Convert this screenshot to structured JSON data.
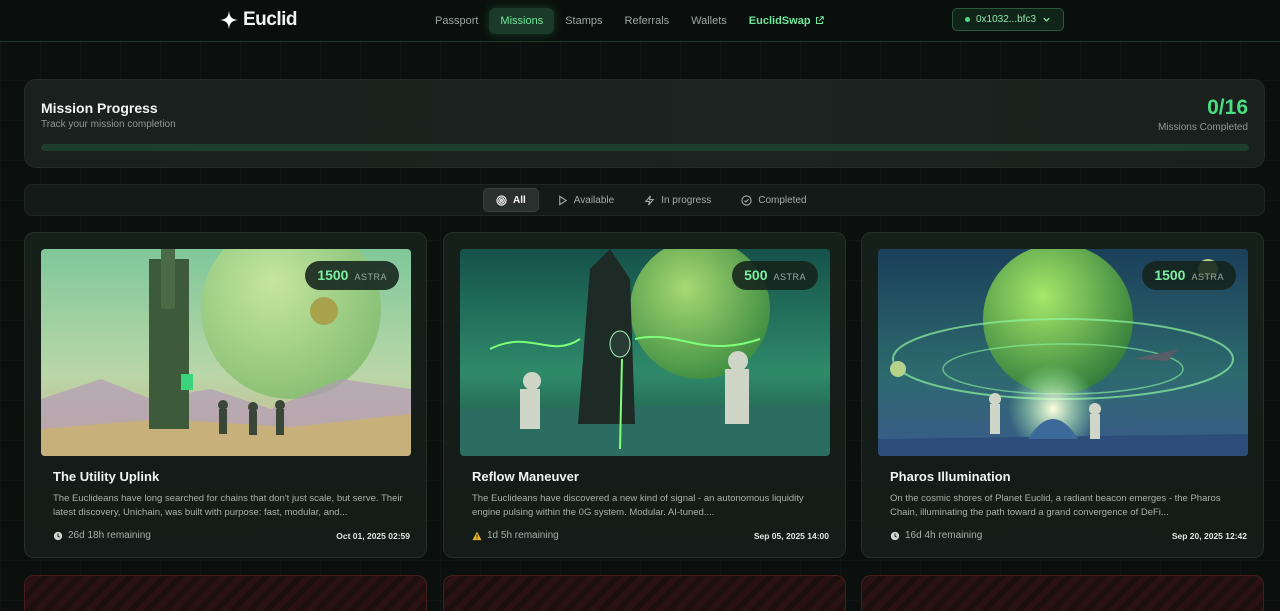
{
  "nav": {
    "logo": "Euclid",
    "items": [
      {
        "label": "Passport",
        "active": false
      },
      {
        "label": "Missions",
        "active": true
      },
      {
        "label": "Stamps",
        "active": false
      },
      {
        "label": "Referrals",
        "active": false
      },
      {
        "label": "Wallets",
        "active": false
      }
    ],
    "external": "EuclidSwap",
    "wallet": "0x1032...bfc3"
  },
  "progress": {
    "title": "Mission Progress",
    "subtitle": "Track your mission completion",
    "count": "0/16",
    "count_label": "Missions Completed",
    "fraction": 0
  },
  "filters": [
    {
      "label": "All",
      "icon": "target-icon",
      "active": true
    },
    {
      "label": "Available",
      "icon": "play-icon",
      "active": false
    },
    {
      "label": "In progress",
      "icon": "bolt-icon",
      "active": false
    },
    {
      "label": "Completed",
      "icon": "check-circle-icon",
      "active": false
    }
  ],
  "missions": [
    {
      "title": "The Utility Uplink",
      "description": "The Euclideans have long searched for chains that don't just scale, but serve. Their latest discovery, Unichain, was built with purpose: fast, modular, and...",
      "reward": "1500",
      "reward_unit": "ASTRA",
      "remaining": "26d 18h remaining",
      "remaining_icon": "clock-icon",
      "date": "Oct 01, 2025 02:59"
    },
    {
      "title": "Reflow Maneuver",
      "description": "The Euclideans have discovered a new kind of signal - an autonomous liquidity engine pulsing within the 0G system. Modular. AI-tuned....",
      "reward": "500",
      "reward_unit": "ASTRA",
      "remaining": "1d 5h remaining",
      "remaining_icon": "warning-icon",
      "date": "Sep 05, 2025 14:00"
    },
    {
      "title": "Pharos Illumination",
      "description": "On the cosmic shores of Planet Euclid, a radiant beacon emerges - the Pharos Chain, illuminating the path toward a grand convergence of DeFi...",
      "reward": "1500",
      "reward_unit": "ASTRA",
      "remaining": "16d 4h remaining",
      "remaining_icon": "clock-icon",
      "date": "Sep 20, 2025 12:42"
    }
  ]
}
